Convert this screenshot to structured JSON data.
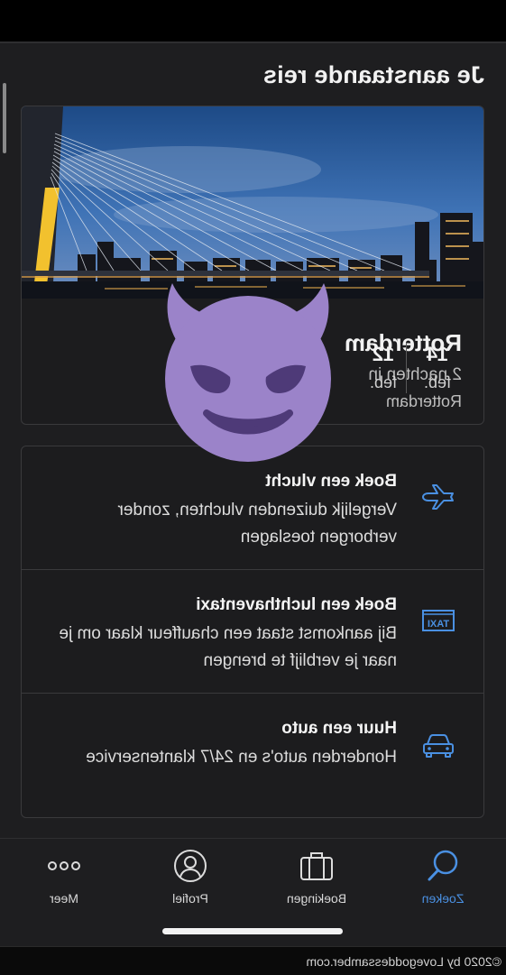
{
  "section_title": "Je aanstaande reis",
  "trip": {
    "city": "Rotterdam",
    "nights": "2 nachten in",
    "location": "Rotterdam",
    "start_day": "12",
    "start_month": "feb.",
    "end_day": "14",
    "end_month": "feb."
  },
  "options": [
    {
      "title": "Boek een vlucht",
      "description": "Vergelijk duizenden vluchten, zonder verborgen toeslagen",
      "icon": "airplane-icon"
    },
    {
      "title": "Boek een luchthaventaxi",
      "description": "Bij aankomst staat een chauffeur klaar om je naar je verblijf te brengen",
      "icon": "taxi-icon",
      "icon_text": "TAXI"
    },
    {
      "title": "Huur een auto",
      "description": "Honderden auto's en 24/7 klantenservice",
      "icon": "car-icon"
    }
  ],
  "nav": [
    {
      "label": "Zoeken",
      "icon": "search-icon",
      "active": true
    },
    {
      "label": "Boekingen",
      "icon": "briefcase-icon"
    },
    {
      "label": "Profiel",
      "icon": "profile-icon"
    },
    {
      "label": "Meer",
      "icon": "more-icon"
    }
  ],
  "overlay": {
    "icon": "smiling-devil-emoji"
  },
  "footer": {
    "copyright": "©2020 by Lovegoddessamber.com"
  },
  "colors": {
    "accent": "#4a90e2",
    "background": "#1e1e20",
    "emoji": "#9b83c9",
    "emoji_feature": "#4e3a78"
  }
}
